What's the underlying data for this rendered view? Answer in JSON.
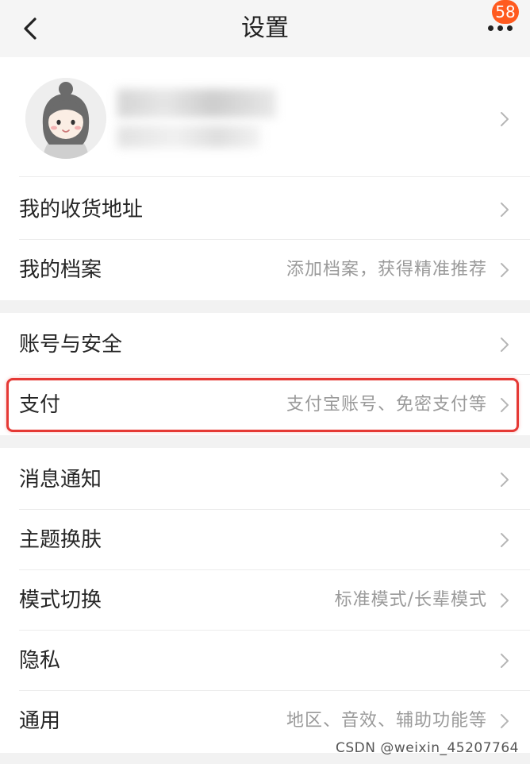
{
  "nav": {
    "title": "设置",
    "back_icon": "chevron-left-icon",
    "more_icon": "more-dots-icon",
    "badge_count": "58"
  },
  "profile": {
    "avatar_icon": "avatar-cartoon-girl",
    "chevron_icon": "chevron-right-icon"
  },
  "groups": [
    {
      "items": [
        {
          "label": "我的收货地址",
          "hint": ""
        },
        {
          "label": "我的档案",
          "hint": "添加档案，获得精准推荐"
        }
      ]
    },
    {
      "items": [
        {
          "label": "账号与安全",
          "hint": ""
        },
        {
          "label": "支付",
          "hint": "支付宝账号、免密支付等"
        }
      ]
    },
    {
      "items": [
        {
          "label": "消息通知",
          "hint": ""
        },
        {
          "label": "主题换肤",
          "hint": ""
        },
        {
          "label": "模式切换",
          "hint": "标准模式/长辈模式"
        },
        {
          "label": "隐私",
          "hint": ""
        },
        {
          "label": "通用",
          "hint": "地区、音效、辅助功能等"
        }
      ]
    }
  ],
  "highlight_color": "#e53935",
  "badge_color": "#ff5a1f",
  "watermark": "CSDN @weixin_45207764"
}
